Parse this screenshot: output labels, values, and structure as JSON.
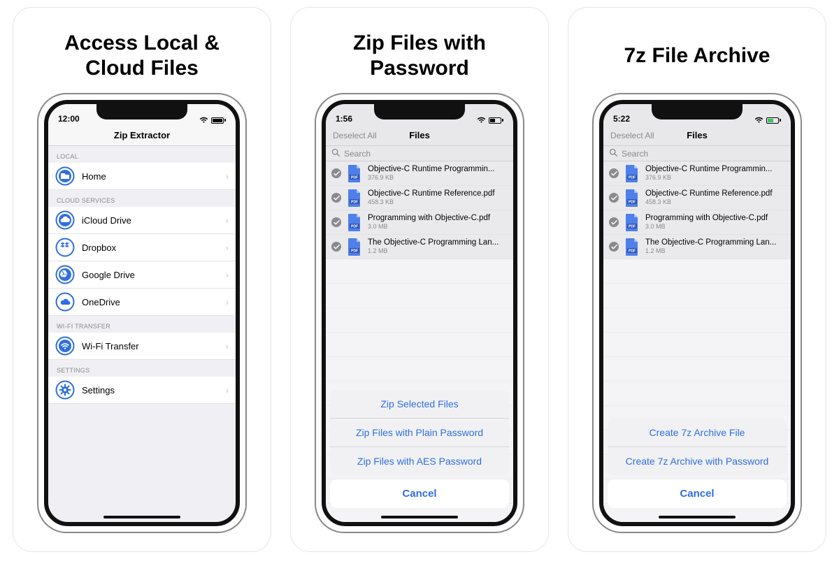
{
  "cards": [
    {
      "headline": "Access Local &\nCloud Files"
    },
    {
      "headline": "Zip Files with\nPassword"
    },
    {
      "headline": "7z File Archive"
    }
  ],
  "phone1": {
    "time": "12:00",
    "title": "Zip Extractor",
    "sections": {
      "local": {
        "header": "LOCAL",
        "items": [
          {
            "label": "Home",
            "icon": "folder"
          }
        ]
      },
      "cloud": {
        "header": "CLOUD SERVICES",
        "items": [
          {
            "label": "iCloud Drive",
            "icon": "cloud"
          },
          {
            "label": "Dropbox",
            "icon": "dropbox"
          },
          {
            "label": "Google Drive",
            "icon": "gdrive"
          },
          {
            "label": "OneDrive",
            "icon": "onedrive"
          }
        ]
      },
      "wifi": {
        "header": "WI-FI TRANSFER",
        "items": [
          {
            "label": "Wi-Fi Transfer",
            "icon": "wifi"
          }
        ]
      },
      "settings": {
        "header": "SETTINGS",
        "items": [
          {
            "label": "Settings",
            "icon": "gear"
          }
        ]
      }
    }
  },
  "phone2": {
    "time": "1:56",
    "nav": {
      "left": "Deselect All",
      "title": "Files"
    },
    "search_placeholder": "Search",
    "files": [
      {
        "name": "Objective-C Runtime Programmin...",
        "size": "376.9 KB"
      },
      {
        "name": "Objective-C Runtime Reference.pdf",
        "size": "458.3 KB"
      },
      {
        "name": "Programming with Objective-C.pdf",
        "size": "3.0 MB"
      },
      {
        "name": "The Objective-C Programming Lan...",
        "size": "1.2 MB"
      }
    ],
    "sheet": {
      "options": [
        "Zip Selected Files",
        "Zip Files with Plain Password",
        "Zip Files with AES Password"
      ],
      "cancel": "Cancel"
    }
  },
  "phone3": {
    "time": "5:22",
    "nav": {
      "left": "Deselect All",
      "title": "Files"
    },
    "search_placeholder": "Search",
    "files": [
      {
        "name": "Objective-C Runtime Programmin...",
        "size": "376.9 KB"
      },
      {
        "name": "Objective-C Runtime Reference.pdf",
        "size": "458.3 KB"
      },
      {
        "name": "Programming with Objective-C.pdf",
        "size": "3.0 MB"
      },
      {
        "name": "The Objective-C Programming Lan...",
        "size": "1.2 MB"
      }
    ],
    "sheet": {
      "options": [
        "Create 7z Archive File",
        "Create 7z Archive with Password"
      ],
      "cancel": "Cancel"
    }
  }
}
